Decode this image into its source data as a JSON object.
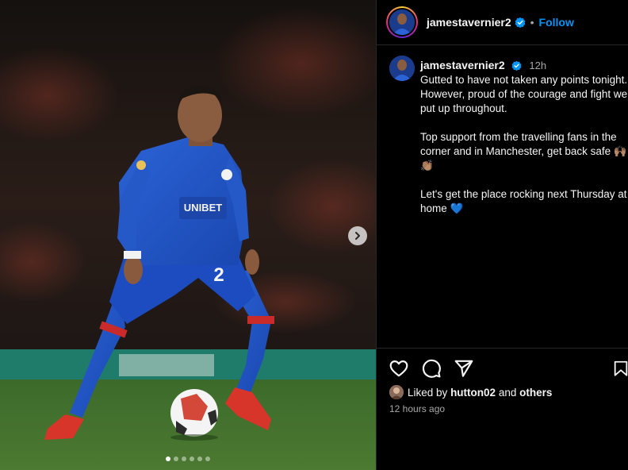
{
  "post": {
    "username": "jamestavernier2",
    "separator": "•",
    "follow_label": "Follow",
    "caption_time": "12h",
    "caption_text": "Gutted to have not taken any points tonight. However, proud of the courage and fight we put up throughout.\n\nTop support from the travelling fans in the corner and in Manchester, get back safe 🙌🏽 👏🏽\n\nLet's get the place rocking next Thursday at home 💙",
    "liked_by_prefix": "Liked by",
    "liked_by_user": "hutton02",
    "liked_by_and": "and",
    "liked_by_others": "others",
    "timestamp": "12 hours ago"
  },
  "media": {
    "shirt_sponsor": "UNIBET",
    "shirt_number": "2",
    "carousel_count": 6,
    "carousel_active": 0
  },
  "icons": {
    "verified": "verified-badge-icon",
    "next": "chevron-right-icon",
    "like": "heart-icon",
    "comment": "comment-icon",
    "share": "paper-plane-icon",
    "save": "bookmark-icon"
  },
  "colors": {
    "accent": "#0095f6",
    "background": "#000000",
    "muted_text": "#a8a8a8",
    "jersey_blue": "#1f52c4"
  }
}
